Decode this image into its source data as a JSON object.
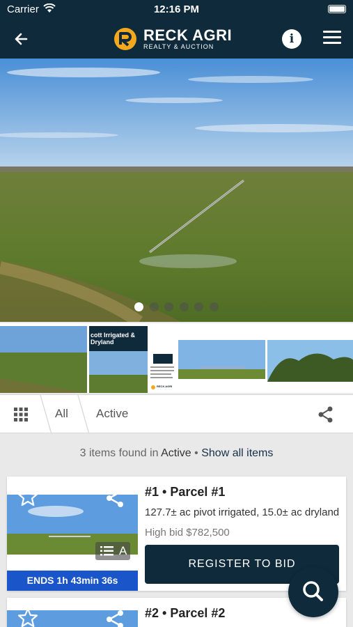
{
  "status_bar": {
    "carrier": "Carrier",
    "time": "12:16 PM"
  },
  "header": {
    "logo_title": "RECK AGRI",
    "logo_subtitle": "REALTY & AUCTION",
    "icons": [
      "back-arrow-icon",
      "info-icon",
      "hamburger-menu-icon"
    ],
    "brand_color": "#0f2a3b",
    "logo_accent": "#f4a81d"
  },
  "gallery": {
    "slide_count": 6,
    "active_slide": 1,
    "thumbnails": [
      {
        "kind": "field-photo"
      },
      {
        "kind": "brochure",
        "text": "cott Irrigated & Dryland",
        "logo_text": "RECK AGRI"
      },
      {
        "kind": "sprinkler-photo"
      },
      {
        "kind": "trees-photo"
      }
    ]
  },
  "filter_bar": {
    "tabs": [
      "All",
      "Active"
    ],
    "icons": [
      "grid-icon",
      "share-icon"
    ]
  },
  "results": {
    "count_text": "3 items found in",
    "filter_name": "Active",
    "separator": "•",
    "show_all": "Show all items"
  },
  "lots": [
    {
      "title": "#1 • Parcel #1",
      "description": "127.7± ac pivot irrigated, 15.0± ac dryland",
      "high_bid": "High bid $782,500",
      "button": "REGISTER TO BID",
      "ends": "ENDS 1h 43min 36s",
      "chip_label": "A"
    },
    {
      "title": "#2 • Parcel #2"
    }
  ],
  "accent_colors": {
    "ends_bar": "#1a55c9"
  },
  "fab": {
    "icon": "search-icon"
  }
}
